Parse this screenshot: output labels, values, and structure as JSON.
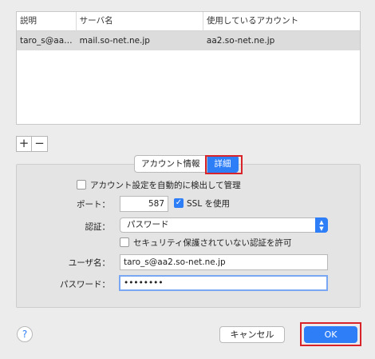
{
  "table": {
    "headers": [
      "説明",
      "サーバ名",
      "使用しているアカウント"
    ],
    "rows": [
      {
        "description": "taro_s@aa2...",
        "server": "mail.so-net.ne.jp",
        "account": "aa2.so-net.ne.jp"
      }
    ]
  },
  "table_controls": {
    "add": "+",
    "remove": "−"
  },
  "tabs": {
    "account_info": "アカウント情報",
    "details": "詳細"
  },
  "settings": {
    "auto_detect_label": "アカウント設定を自動的に検出して管理",
    "auto_detect_checked": false,
    "port_label": "ポート：",
    "port_value": "587",
    "ssl_label": "SSL を使用",
    "ssl_checked": true,
    "auth_label": "認証：",
    "auth_value": "パスワード",
    "insecure_auth_label": "セキュリティ保護されていない認証を許可",
    "insecure_auth_checked": false,
    "username_label": "ユーザ名：",
    "username_value": "taro_s@aa2.so-net.ne.jp",
    "password_label": "パスワード：",
    "password_value": "••••••••"
  },
  "footer": {
    "help": "?",
    "cancel": "キャンセル",
    "ok": "OK"
  },
  "colors": {
    "accent": "#2d7ef7",
    "highlight": "#d9232a"
  }
}
